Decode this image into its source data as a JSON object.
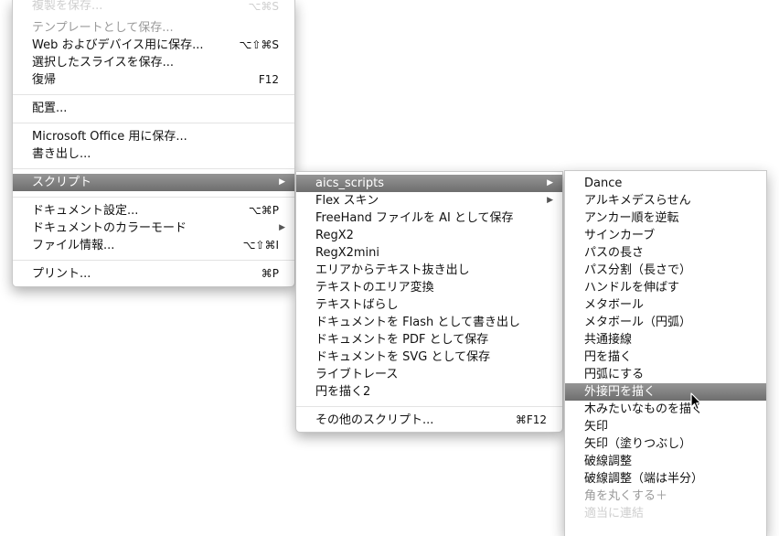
{
  "file_menu": {
    "items": [
      {
        "label": "複製を保存...",
        "shortcut": "⌥⌘S"
      },
      {
        "label": "テンプレートとして保存..."
      },
      {
        "label": "Web およびデバイス用に保存...",
        "shortcut": "⌥⇧⌘S"
      },
      {
        "label": "選択したスライスを保存..."
      },
      {
        "label": "復帰",
        "shortcut": "F12"
      },
      {
        "label": "配置..."
      },
      {
        "label": "Microsoft Office 用に保存..."
      },
      {
        "label": "書き出し..."
      },
      {
        "label": "スクリプト"
      },
      {
        "label": "ドキュメント設定...",
        "shortcut": "⌥⌘P"
      },
      {
        "label": "ドキュメントのカラーモード"
      },
      {
        "label": "ファイル情報...",
        "shortcut": "⌥⇧⌘I"
      },
      {
        "label": "プリント...",
        "shortcut": "⌘P"
      }
    ]
  },
  "scripts_menu": {
    "items": [
      {
        "label": "aics_scripts"
      },
      {
        "label": "Flex スキン"
      },
      {
        "label": "FreeHand ファイルを AI として保存"
      },
      {
        "label": "RegX2"
      },
      {
        "label": "RegX2mini"
      },
      {
        "label": "エリアからテキスト抜き出し"
      },
      {
        "label": "テキストのエリア変換"
      },
      {
        "label": "テキストばらし"
      },
      {
        "label": "ドキュメントを Flash として書き出し"
      },
      {
        "label": "ドキュメントを PDF として保存"
      },
      {
        "label": "ドキュメントを SVG として保存"
      },
      {
        "label": "ライブトレース"
      },
      {
        "label": "円を描く2"
      },
      {
        "label": "その他のスクリプト...",
        "shortcut": "⌘F12"
      }
    ]
  },
  "aics_menu": {
    "items": [
      {
        "label": "Dance"
      },
      {
        "label": "アルキメデスらせん"
      },
      {
        "label": "アンカー順を逆転"
      },
      {
        "label": "サインカーブ"
      },
      {
        "label": "パスの長さ"
      },
      {
        "label": "パス分割（長さで）"
      },
      {
        "label": "ハンドルを伸ばす"
      },
      {
        "label": "メタボール"
      },
      {
        "label": "メタボール（円弧）"
      },
      {
        "label": "共通接線"
      },
      {
        "label": "円を描く"
      },
      {
        "label": "円弧にする"
      },
      {
        "label": "外接円を描く"
      },
      {
        "label": "木みたいなものを描く"
      },
      {
        "label": "矢印"
      },
      {
        "label": "矢印（塗りつぶし）"
      },
      {
        "label": "破線調整"
      },
      {
        "label": "破線調整（端は半分）"
      },
      {
        "label": "角を丸くする＋"
      },
      {
        "label": "適当に連結"
      }
    ]
  },
  "colors": {
    "highlight": "#7d7d7d",
    "text": "#111111"
  }
}
